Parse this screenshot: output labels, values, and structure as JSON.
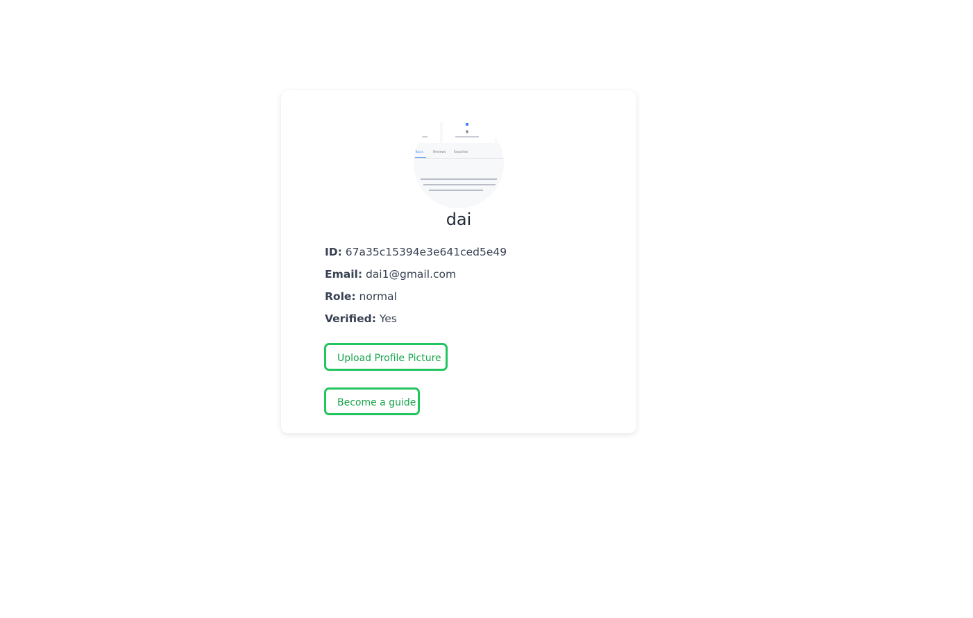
{
  "profile": {
    "username": "dai",
    "fields": [
      {
        "label": "ID:",
        "value": "67a35c15394e3e641ced5e49"
      },
      {
        "label": "Email:",
        "value": "dai1@gmail.com"
      },
      {
        "label": "Role:",
        "value": "normal"
      },
      {
        "label": "Verified:",
        "value": "Yes"
      }
    ]
  },
  "avatar_image": {
    "tabs": [
      "Tours",
      "Reviews",
      "Favorites"
    ],
    "stat_value": "8"
  },
  "actions": {
    "upload_label": "Upload Profile Picture",
    "guide_label": "Become a guide"
  },
  "colors": {
    "accent": "#22c55e",
    "accent_text": "#16a34a",
    "text": "#374151",
    "heading": "#1f2937"
  }
}
